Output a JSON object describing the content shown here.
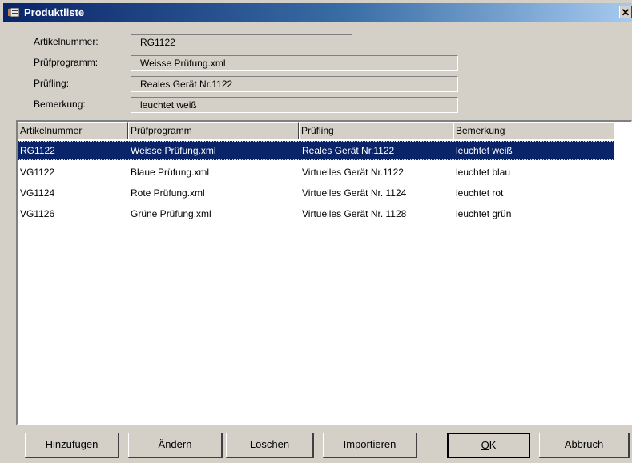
{
  "window": {
    "title": "Produktliste",
    "close": "✕"
  },
  "fields": {
    "artikelnummer": {
      "label": "Artikelnummer:",
      "value": "RG1122"
    },
    "pruefprogramm": {
      "label": "Prüfprogramm:",
      "value": "Weisse Prüfung.xml"
    },
    "pruefling": {
      "label": "Prüfling:",
      "value": "Reales Gerät Nr.1122"
    },
    "bemerkung": {
      "label": "Bemerkung:",
      "value": "leuchtet weiß"
    }
  },
  "table": {
    "columns": [
      "Artikelnummer",
      "Prüfprogramm",
      "Prüfling",
      "Bemerkung"
    ],
    "rows": [
      [
        "RG1122",
        "Weisse Prüfung.xml",
        "Reales Gerät Nr.1122",
        "leuchtet weiß"
      ],
      [
        "VG1122",
        "Blaue Prüfung.xml",
        "Virtuelles Gerät Nr.1122",
        "leuchtet blau"
      ],
      [
        "VG1124",
        "Rote Prüfung.xml",
        "Virtuelles Gerät Nr. 1124",
        "leuchtet rot"
      ],
      [
        "VG1126",
        "Grüne Prüfung.xml",
        "Virtuelles Gerät Nr. 1128",
        "leuchtet grün"
      ]
    ],
    "selected_row": 0
  },
  "buttons": {
    "hinzufuegen": {
      "pre": "Hinz",
      "u": "u",
      "post": "fügen"
    },
    "aendern": {
      "pre": "",
      "u": "Ä",
      "post": "ndern"
    },
    "loeschen": {
      "pre": "",
      "u": "L",
      "post": "öschen"
    },
    "importieren": {
      "pre": "",
      "u": "I",
      "post": "mportieren"
    },
    "ok": {
      "pre": "",
      "u": "O",
      "post": "K"
    },
    "abbruch": {
      "pre": "Abbruch",
      "u": "",
      "post": ""
    }
  },
  "colors": {
    "selection": "#0a246a",
    "dialog": "#d4d0c8",
    "titlebar_start": "#0a246a",
    "titlebar_end": "#a6caf0"
  }
}
